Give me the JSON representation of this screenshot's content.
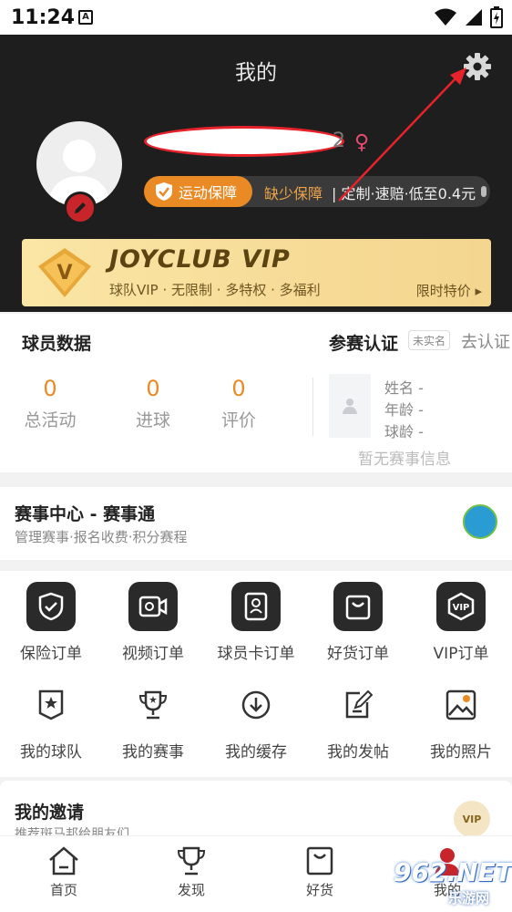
{
  "status_bar": {
    "time": "11:24",
    "notification": "A"
  },
  "header": {
    "title": "我的",
    "username_tail": "2",
    "gender_symbol": "♀"
  },
  "insurance": {
    "pill_label": "运动保障",
    "missing_label": "缺少保障",
    "offer_label": "| 定制·速赔·低至0.4元"
  },
  "vip_banner": {
    "logo_letter": "V",
    "brand": "JOYCLUB VIP",
    "subtitle": "球队VIP · 无限制 · 多特权 · 多福利",
    "price_label": "限时特价 ▸"
  },
  "player_data": {
    "title": "球员数据",
    "stats": [
      {
        "value": "0",
        "label": "总活动"
      },
      {
        "value": "0",
        "label": "进球"
      },
      {
        "value": "0",
        "label": "评价"
      }
    ],
    "cert_title": "参赛认证",
    "cert_badge": "未实名",
    "cert_link": "去认证",
    "fields": [
      "姓名 -",
      "年龄 -",
      "球龄 -"
    ],
    "empty_text": "暂无赛事信息"
  },
  "match_center": {
    "title": "赛事中心 - 赛事通",
    "subtitle": "管理赛事·报名收费·积分赛程"
  },
  "grid_items": [
    {
      "label": "保险订单",
      "icon": "shield-icon"
    },
    {
      "label": "视频订单",
      "icon": "video-icon"
    },
    {
      "label": "球员卡订单",
      "icon": "player-card-icon"
    },
    {
      "label": "好货订单",
      "icon": "bag-icon"
    },
    {
      "label": "VIP订单",
      "icon": "vip-icon"
    },
    {
      "label": "我的球队",
      "icon": "team-badge-icon"
    },
    {
      "label": "我的赛事",
      "icon": "trophy-icon"
    },
    {
      "label": "我的缓存",
      "icon": "download-icon"
    },
    {
      "label": "我的发帖",
      "icon": "edit-icon"
    },
    {
      "label": "我的照片",
      "icon": "photo-icon"
    }
  ],
  "invite": {
    "title": "我的邀请",
    "subtitle": "推荐斑马邦给朋友们",
    "badge": "VIP"
  },
  "bottom_nav": [
    {
      "label": "首页",
      "icon": "home-icon"
    },
    {
      "label": "发现",
      "icon": "trophy-icon"
    },
    {
      "label": "好货",
      "icon": "bag-icon"
    },
    {
      "label": "我的",
      "icon": "profile-icon"
    }
  ],
  "watermark": {
    "main": "962.NET",
    "sub": "乐游网"
  },
  "colors": {
    "accent": "#e98a25",
    "header_bg": "#1e1e1e",
    "annotation": "#e8222a"
  }
}
